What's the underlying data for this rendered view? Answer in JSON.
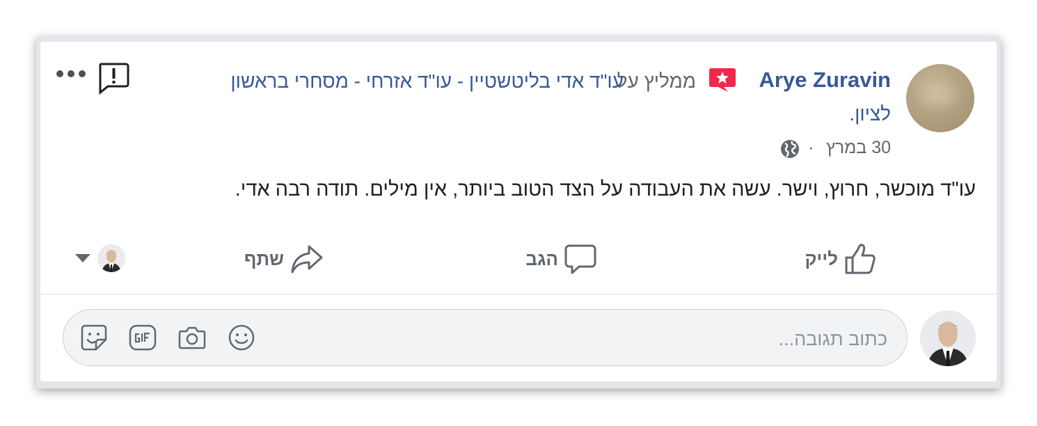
{
  "review": {
    "author": "Arye Zuravin",
    "recommends_text": "ממליץ על",
    "business_line1": "עו\"ד אדי בליטשטיין - עו\"ד אזרחי - מסחרי בראשון",
    "business_line2": "לציון.",
    "date": "30 במרץ",
    "separator": "·",
    "privacy_icon": "globe-icon",
    "body": "עו\"ד מוכשר, חרוץ, וישר. עשה את העבודה על הצד הטוב ביותר, אין מילים. תודה רבה אדי."
  },
  "actions": {
    "like_label": "לייק",
    "comment_label": "הגב",
    "share_label": "שתף"
  },
  "comment_box": {
    "placeholder": "כתוב תגובה...",
    "value": ""
  },
  "icons": {
    "recommend_badge": "star-speech-bubble-icon",
    "report": "report-exclamation-icon",
    "more": "more-dots-icon",
    "emoji": "smiley-icon",
    "camera": "camera-icon",
    "gif": "gif-icon",
    "sticker": "sticker-icon"
  },
  "colors": {
    "link_blue": "#385898",
    "secondary_text": "#606770",
    "badge_red": "#f0284a"
  }
}
